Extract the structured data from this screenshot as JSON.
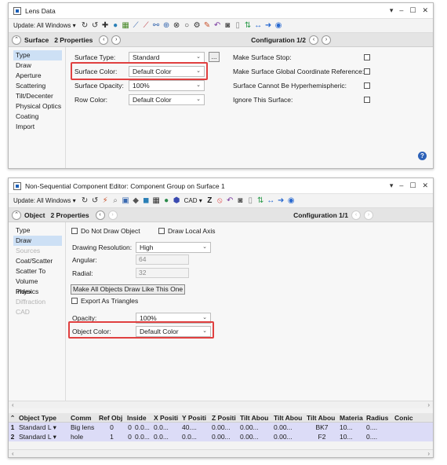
{
  "lens_data": {
    "title": "Lens Data",
    "window_controls": [
      "▾",
      "–",
      "☐",
      "✕"
    ],
    "toolbar": {
      "update_label": "Update: All Windows ▾",
      "icons": [
        "refresh-icon",
        "refresh-all-icon",
        "add-icon",
        "sphere-icon",
        "chart-icon",
        "ray-icon",
        "ray2-icon",
        "lens-icon",
        "lens2-icon",
        "circle-icon",
        "gear-icon",
        "pencil-icon",
        "undo-icon",
        "toggle-icon",
        "doc-icon",
        "swap-icon",
        "arrows-icon",
        "arrow-icon",
        "help-icon"
      ]
    },
    "header": {
      "label": "Surface",
      "props": "2 Properties",
      "config": "Configuration 1/2"
    },
    "nav": [
      "Type",
      "Draw",
      "Aperture",
      "Scattering",
      "Tilt/Decenter",
      "Physical Optics",
      "Coating",
      "Import"
    ],
    "fields": {
      "surface_type_label": "Surface Type:",
      "surface_type_value": "Standard",
      "surface_color_label": "Surface Color:",
      "surface_color_value": "Default Color",
      "surface_opacity_label": "Surface Opacity:",
      "surface_opacity_value": "100%",
      "row_color_label": "Row Color:",
      "row_color_value": "Default Color",
      "browse_label": "..."
    },
    "checks": {
      "make_stop": "Make Surface Stop:",
      "global_ref": "Make Surface Global Coordinate Reference:",
      "hyperhemi": "Surface Cannot Be Hyperhemispheric:",
      "ignore": "Ignore This Surface:"
    }
  },
  "nsc_editor": {
    "title": "Non-Sequential Component Editor: Component Group on Surface 1",
    "window_controls": [
      "▾",
      "–",
      "☐",
      "✕"
    ],
    "toolbar": {
      "update_label": "Update: All Windows ▾",
      "z_label": "Z",
      "cad_label": "CAD ▾"
    },
    "header": {
      "label": "Object",
      "props": "2 Properties",
      "config": "Configuration 1/1"
    },
    "nav": [
      "Type",
      "Draw",
      "Sources",
      "Coat/Scatter",
      "Scatter To",
      "Volume Physics",
      "Index",
      "Diffraction",
      "CAD"
    ],
    "fields": {
      "do_not_draw": "Do Not Draw Object",
      "draw_local_axis": "Draw Local Axis",
      "drawing_resolution_label": "Drawing Resolution:",
      "drawing_resolution_value": "High",
      "angular_label": "Angular:",
      "angular_value": "64",
      "radial_label": "Radial:",
      "radial_value": "32",
      "make_all_button": "Make All Objects Draw Like This One",
      "export_triangles": "Export As Triangles",
      "opacity_label": "Opacity:",
      "opacity_value": "100%",
      "object_color_label": "Object Color:",
      "object_color_value": "Default Color"
    },
    "table": {
      "columns": [
        "Object Type",
        "Comm",
        "Ref Obj",
        "Inside",
        "X Positi",
        "Y Positi",
        "Z Positi",
        "Tilt Abou",
        "Tilt Abou",
        "Tilt Abou",
        "Materia",
        "Radius",
        "Conic"
      ],
      "rows": [
        [
          "1",
          "Standard L ▾",
          "Big lens",
          "0",
          "0",
          "0.0...",
          "0.0...",
          "40....",
          "0.00...",
          "0.00...",
          "0.00...",
          "BK7",
          "10...",
          "0...."
        ],
        [
          "2",
          "Standard L ▾",
          "hole",
          "1",
          "0",
          "0.0...",
          "0.0...",
          "0.0...",
          "0.00...",
          "0.00...",
          "0.00...",
          "F2",
          "10...",
          "0...."
        ]
      ]
    }
  },
  "colors": {
    "highlight": "#e04040",
    "selection": "#cde0f5",
    "table_row": "#dcdcf7",
    "help": "#2d62b8"
  }
}
